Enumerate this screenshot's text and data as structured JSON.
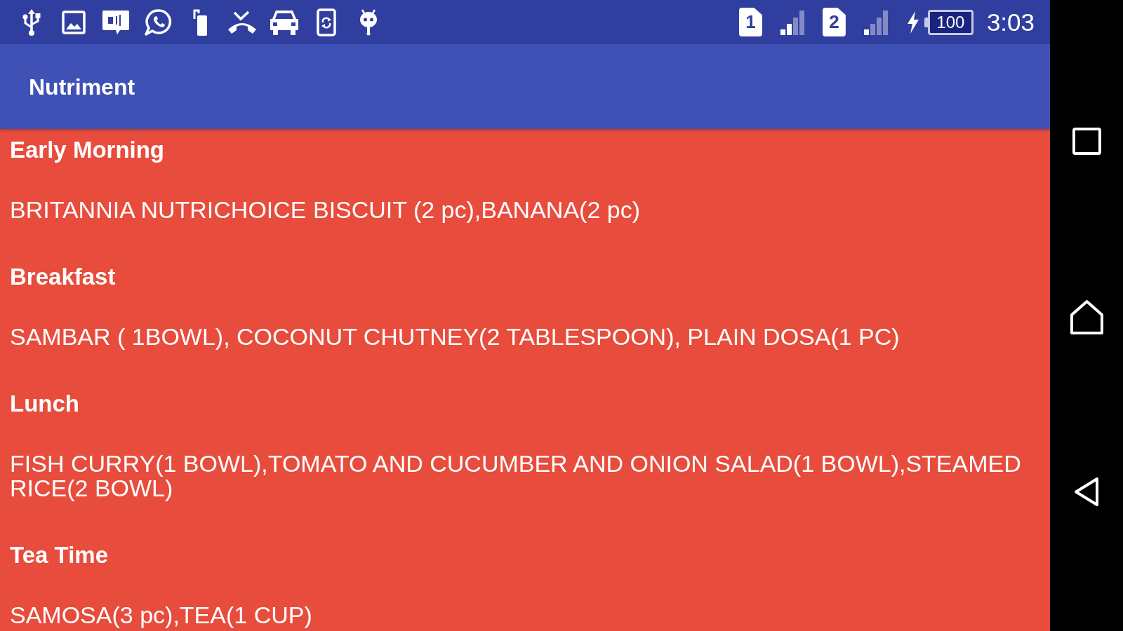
{
  "status_bar": {
    "sims": [
      {
        "label": "1"
      },
      {
        "label": "2"
      }
    ],
    "battery": {
      "reading": "100",
      "charging": true
    },
    "time": "3:03"
  },
  "app_bar": {
    "title": "Nutriment"
  },
  "meals": [
    {
      "title": "Early Morning",
      "items": "BRITANNIA NUTRICHOICE BISCUIT (2 pc),BANANA(2 pc)"
    },
    {
      "title": "Breakfast",
      "items": "SAMBAR ( 1BOWL), COCONUT CHUTNEY(2 TABLESPOON), PLAIN DOSA(1 PC)"
    },
    {
      "title": "Lunch",
      "items": "FISH CURRY(1 BOWL),TOMATO AND CUCUMBER AND ONION SALAD(1 BOWL),STEAMED RICE(2 BOWL)"
    },
    {
      "title": "Tea Time",
      "items": "SAMOSA(3 pc),TEA(1 CUP)"
    }
  ]
}
